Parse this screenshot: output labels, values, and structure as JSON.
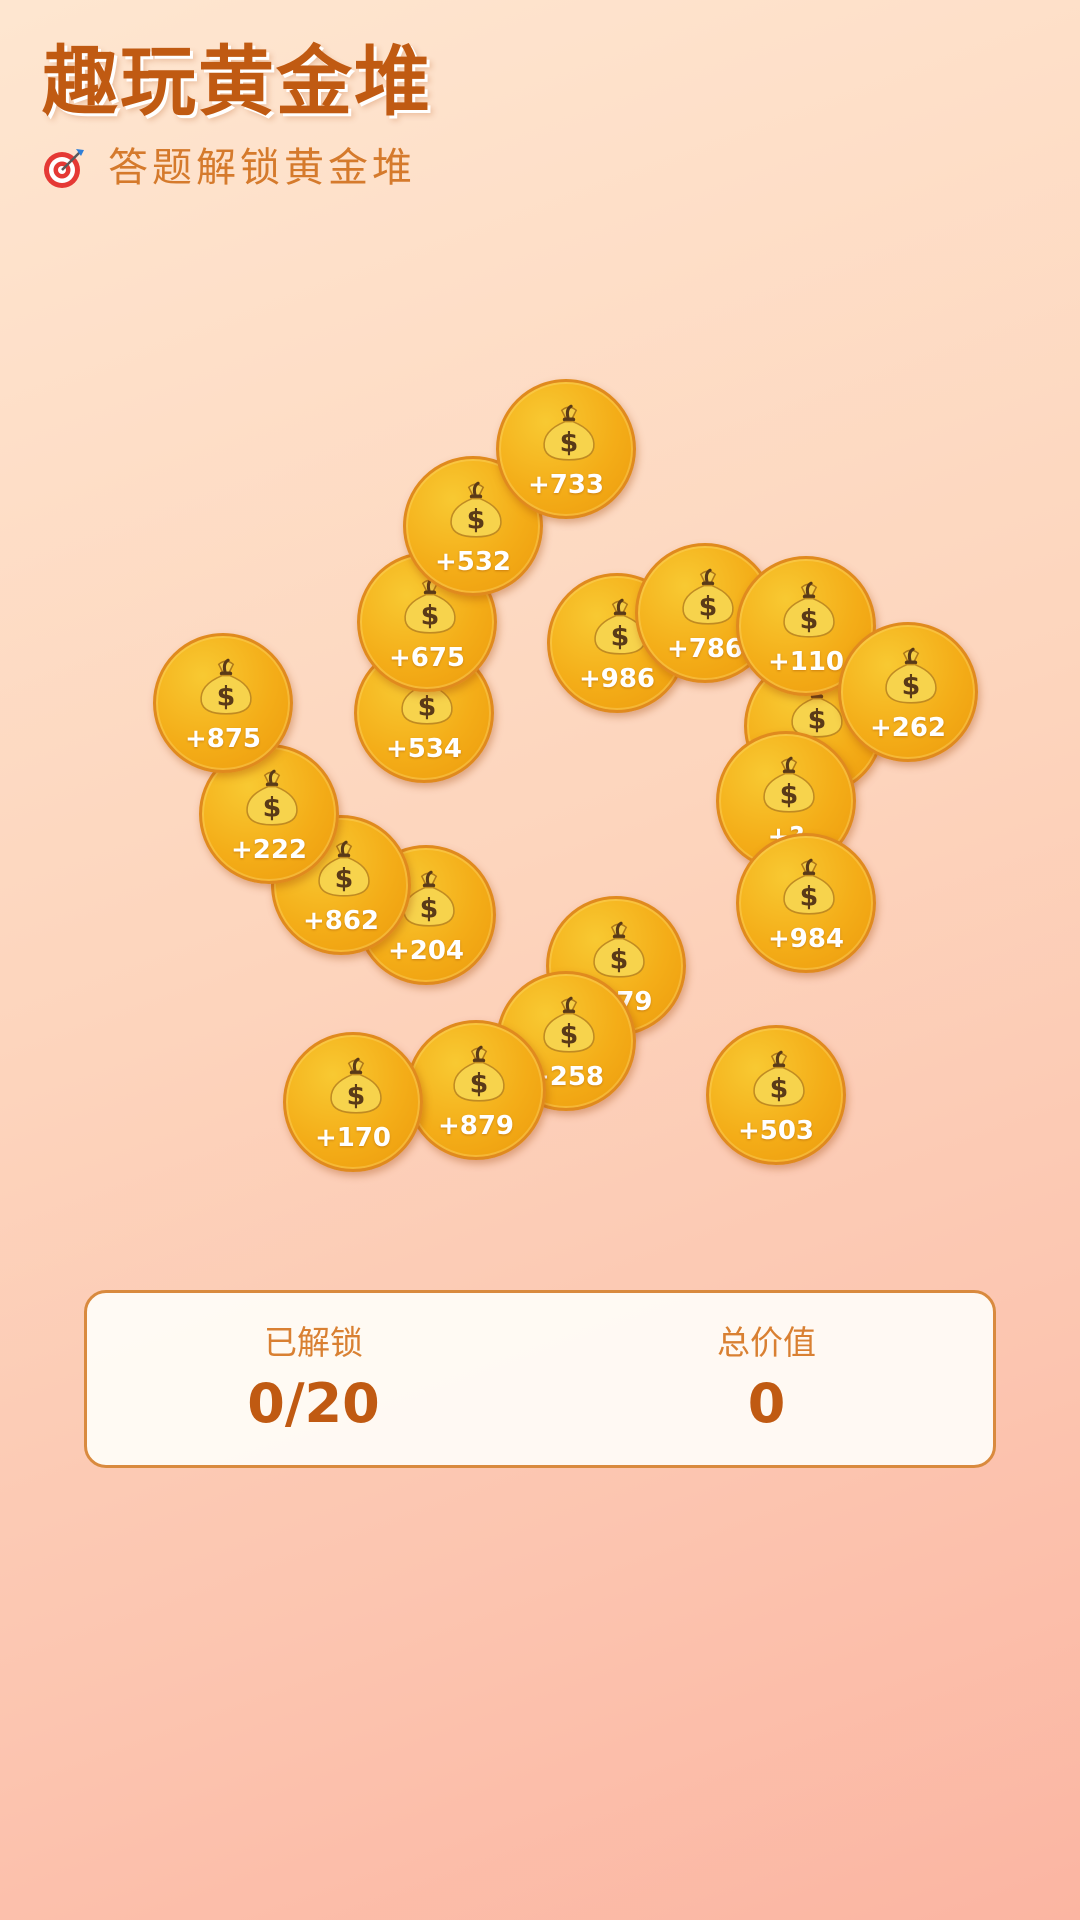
{
  "header": {
    "title": "趣玩黄金堆",
    "subtitle": "答题解锁黄金堆",
    "subtitle_icon": "target-icon"
  },
  "coins": [
    {
      "value": "+170"
    },
    {
      "value": "+879"
    },
    {
      "value": "+875"
    },
    {
      "value": "+222"
    },
    {
      "value": "+204"
    },
    {
      "value": "+862"
    },
    {
      "value": "+534"
    },
    {
      "value": "+675"
    },
    {
      "value": "+532"
    },
    {
      "value": "+733"
    },
    {
      "value": "+986"
    },
    {
      "value": "+786"
    },
    {
      "value": "+110"
    },
    {
      "value": "+262"
    },
    {
      "value": "+?"
    },
    {
      "value": "+?"
    },
    {
      "value": "+?79"
    },
    {
      "value": "+258"
    },
    {
      "value": "+984"
    },
    {
      "value": "+503"
    }
  ],
  "stats": {
    "unlocked_label": "已解锁",
    "unlocked_value": "0/20",
    "total_label": "总价值",
    "total_value": "0"
  },
  "colors": {
    "coin": "#f4ad18",
    "coin_border": "#e08a1e",
    "title": "#c05a12",
    "accent": "#d98032"
  }
}
